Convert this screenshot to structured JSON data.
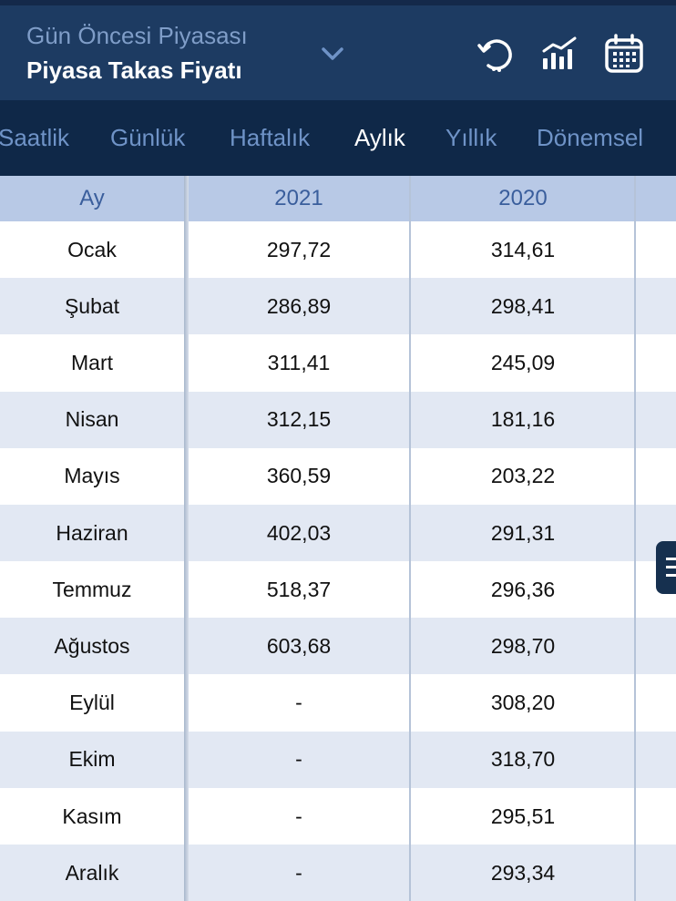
{
  "header": {
    "subtitle": "Gün Öncesi Piyasası",
    "title": "Piyasa Takas Fiyatı",
    "icons": [
      "chevron-down-icon",
      "refresh-icon",
      "chart-icon",
      "calendar-icon"
    ]
  },
  "tabs": [
    {
      "label": "Saatlik",
      "active": false
    },
    {
      "label": "Günlük",
      "active": false
    },
    {
      "label": "Haftalık",
      "active": false
    },
    {
      "label": "Aylık",
      "active": true
    },
    {
      "label": "Yıllık",
      "active": false
    },
    {
      "label": "Dönemsel",
      "active": false
    }
  ],
  "table": {
    "headers": [
      "Ay",
      "2021",
      "2020"
    ],
    "rows": [
      {
        "month": "Ocak",
        "y2021": "297,72",
        "y2020": "314,61"
      },
      {
        "month": "Şubat",
        "y2021": "286,89",
        "y2020": "298,41"
      },
      {
        "month": "Mart",
        "y2021": "311,41",
        "y2020": "245,09"
      },
      {
        "month": "Nisan",
        "y2021": "312,15",
        "y2020": "181,16"
      },
      {
        "month": "Mayıs",
        "y2021": "360,59",
        "y2020": "203,22"
      },
      {
        "month": "Haziran",
        "y2021": "402,03",
        "y2020": "291,31"
      },
      {
        "month": "Temmuz",
        "y2021": "518,37",
        "y2020": "296,36"
      },
      {
        "month": "Ağustos",
        "y2021": "603,68",
        "y2020": "298,70"
      },
      {
        "month": "Eylül",
        "y2021": "-",
        "y2020": "308,20"
      },
      {
        "month": "Ekim",
        "y2021": "-",
        "y2020": "318,70"
      },
      {
        "month": "Kasım",
        "y2021": "-",
        "y2020": "295,51"
      },
      {
        "month": "Aralık",
        "y2021": "-",
        "y2020": "293,34"
      }
    ]
  },
  "colors": {
    "header_bg": "#1d3b62",
    "tabs_bg": "#0f2848",
    "table_header_bg": "#b8c9e6",
    "row_alt_bg": "#e2e8f3"
  }
}
